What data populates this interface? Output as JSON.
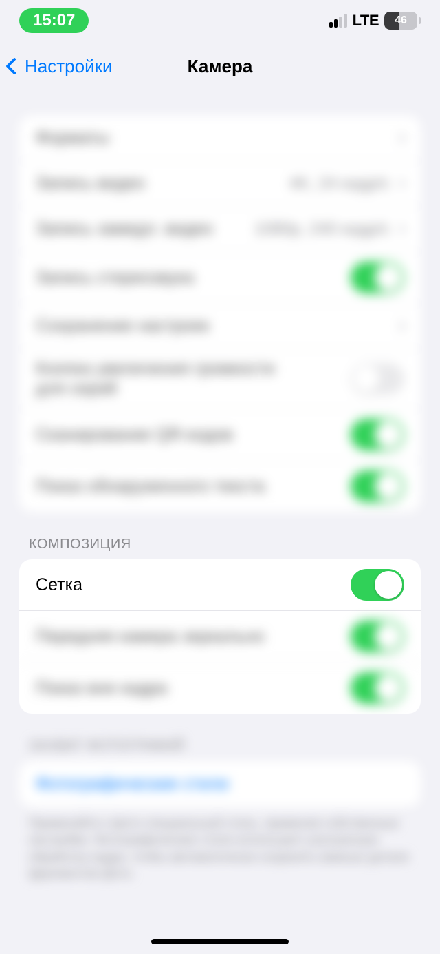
{
  "status": {
    "time": "15:07",
    "network": "LTE",
    "battery_pct": "46"
  },
  "nav": {
    "back_label": "Настройки",
    "title": "Камера"
  },
  "section1": {
    "formats": "Форматы",
    "video_label": "Запись видео",
    "video_value": "4K, 24 кадр/с",
    "slomo_label": "Запись замедл. видео",
    "slomo_value": "1080p, 240 кадр/с",
    "stereo": "Запись стереозвука",
    "preserve": "Сохранение настроек",
    "volume_burst": "Кнопка увеличения громкости для серий",
    "qr": "Сканирование QR-кодов",
    "text": "Показ обнаруженного текста"
  },
  "section2_header": "КОМПОЗИЦИЯ",
  "section2": {
    "grid": "Сетка",
    "mirror": "Передняя камера зеркально",
    "outside": "Показ вне кадра"
  },
  "section3_header": "ЗАХВАТ ФОТОГРАФИЙ",
  "section3": {
    "styles": "Фотографические стили"
  },
  "footer_note": "Применяйте к фото специальный стиль, применяя собственные настройки. Фотографические стили используют улучшенную обработку кадра, чтобы автоматически сохранять важные детали фрагментов фото."
}
